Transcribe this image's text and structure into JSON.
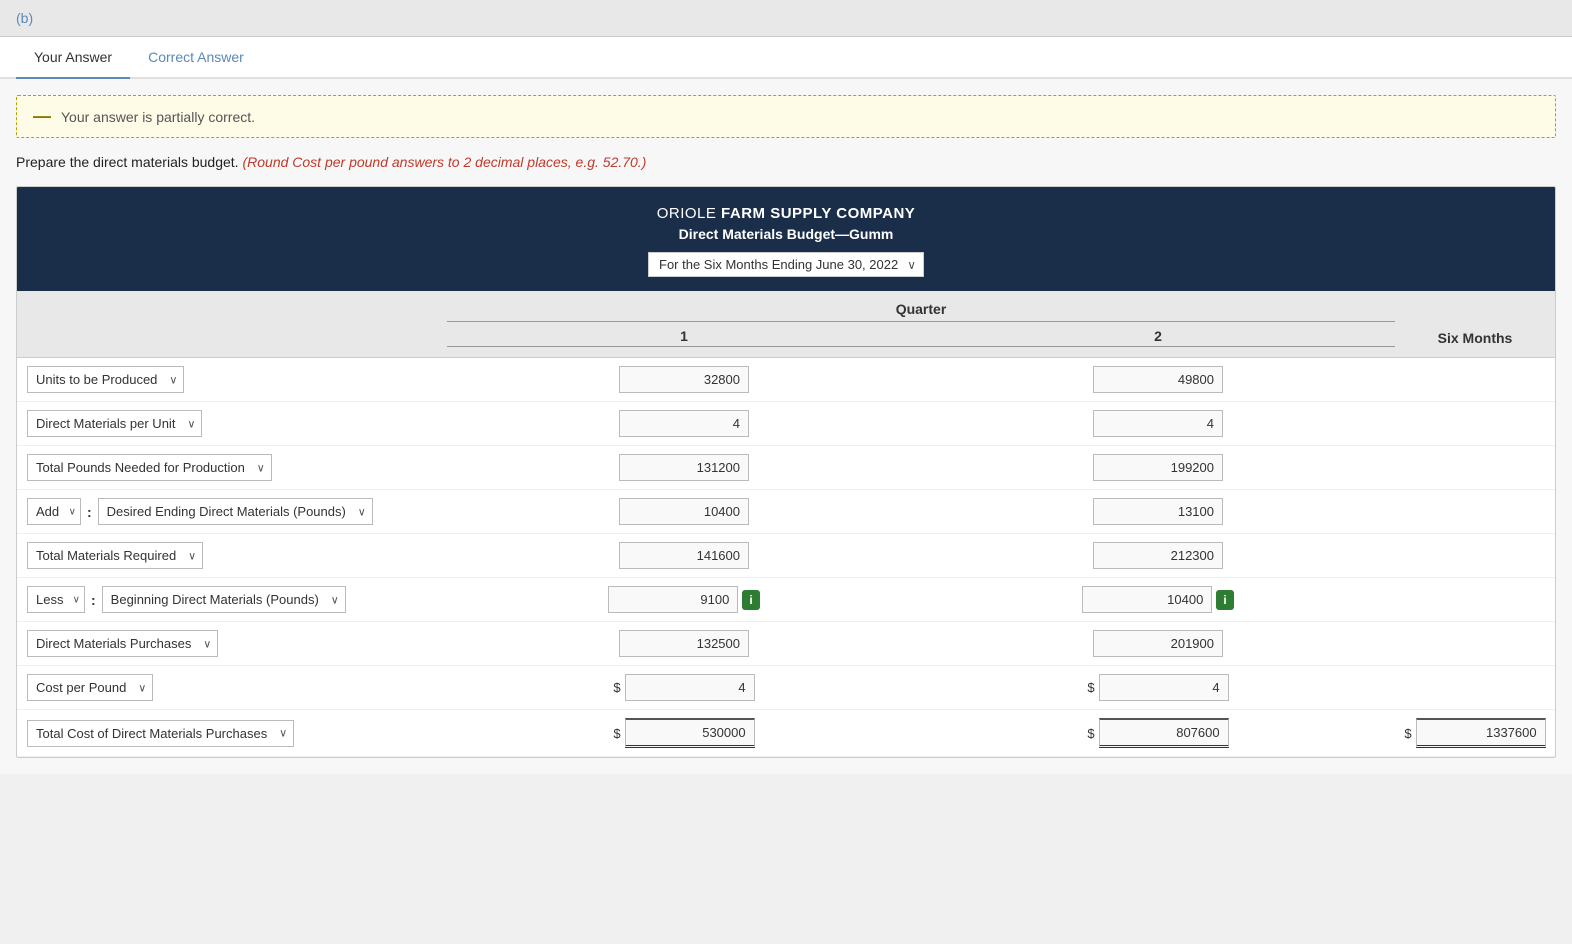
{
  "topBar": {
    "label": "(b)"
  },
  "tabs": [
    {
      "id": "your-answer",
      "label": "Your Answer",
      "active": true
    },
    {
      "id": "correct-answer",
      "label": "Correct Answer",
      "active": false
    }
  ],
  "notice": {
    "text": "Your answer is partially correct."
  },
  "instruction": {
    "prefix": "Prepare the direct materials budget.",
    "note": "(Round Cost per pound answers to 2 decimal places, e.g. 52.70.)"
  },
  "tableHeader": {
    "companyName": "ORIOLE FARM SUPPLY COMPANY",
    "companyNameBold": "FARM SUPPLY COMPANY",
    "budgetTitle": "Direct Materials Budget—Gumm",
    "period": "For the Six Months Ending June 30, 2022"
  },
  "columns": {
    "quarter": "Quarter",
    "q1": "1",
    "q2": "2",
    "sixMonths": "Six Months"
  },
  "rows": [
    {
      "id": "units-produced",
      "label": "Units to be Produced",
      "q1": "32800",
      "q2": "49800",
      "sixMonths": "",
      "q1Prefix": "",
      "q2Prefix": "",
      "smPrefix": "",
      "q1Info": false,
      "q2Info": false
    },
    {
      "id": "direct-materials",
      "label": "Direct Materials per Unit",
      "q1": "4",
      "q2": "4",
      "sixMonths": "",
      "q1Prefix": "",
      "q2Prefix": "",
      "smPrefix": "",
      "q1Info": false,
      "q2Info": false
    },
    {
      "id": "total-pounds",
      "label": "Total Pounds Needed for Production",
      "q1": "131200",
      "q2": "199200",
      "sixMonths": "",
      "q1Prefix": "",
      "q2Prefix": "",
      "smPrefix": "",
      "q1Info": false,
      "q2Info": false
    },
    {
      "id": "add-ending",
      "label": "Desired Ending Direct Materials (Pounds)",
      "labelPrefix": "Add",
      "q1": "10400",
      "q2": "13100",
      "sixMonths": "",
      "q1Prefix": "",
      "q2Prefix": "",
      "smPrefix": "",
      "q1Info": false,
      "q2Info": false,
      "compound": true,
      "compoundPrefix": "Add"
    },
    {
      "id": "total-materials",
      "label": "Total Materials Required",
      "q1": "141600",
      "q2": "212300",
      "sixMonths": "",
      "q1Prefix": "",
      "q2Prefix": "",
      "smPrefix": "",
      "q1Info": false,
      "q2Info": false
    },
    {
      "id": "less-beginning",
      "label": "Beginning Direct Materials (Pounds)",
      "labelPrefix": "Less",
      "q1": "9100",
      "q2": "10400",
      "sixMonths": "",
      "q1Prefix": "",
      "q2Prefix": "",
      "smPrefix": "",
      "q1Info": true,
      "q2Info": true,
      "compound": true,
      "compoundPrefix": "Less"
    },
    {
      "id": "dm-purchases",
      "label": "Direct Materials Purchases",
      "q1": "132500",
      "q2": "201900",
      "sixMonths": "",
      "q1Prefix": "",
      "q2Prefix": "",
      "smPrefix": "",
      "q1Info": false,
      "q2Info": false
    },
    {
      "id": "cost-per-pound",
      "label": "Cost per Pound",
      "q1": "4",
      "q2": "4",
      "sixMonths": "",
      "q1Prefix": "$",
      "q2Prefix": "$",
      "smPrefix": "",
      "q1Info": false,
      "q2Info": false
    },
    {
      "id": "total-cost",
      "label": "Total Cost of Direct Materials Purchases",
      "q1": "530000",
      "q2": "807600",
      "sixMonths": "1337600",
      "q1Prefix": "$",
      "q2Prefix": "$",
      "smPrefix": "$",
      "q1Info": false,
      "q2Info": false
    }
  ],
  "buttons": {
    "infoLabel": "i"
  }
}
